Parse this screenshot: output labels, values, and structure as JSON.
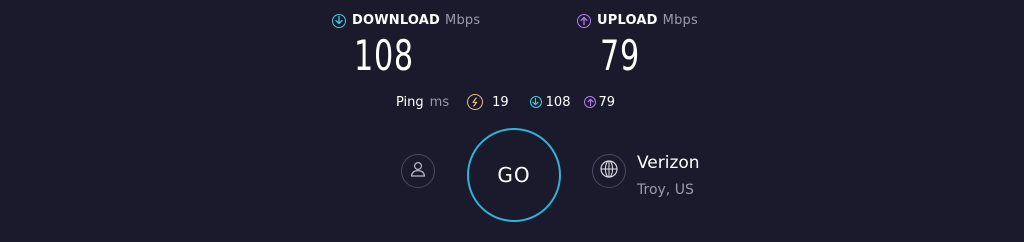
{
  "download": {
    "label": "DOWNLOAD",
    "unit": "Mbps",
    "value": "108",
    "icon": "download-arrow-icon",
    "color": "#3dd0e3"
  },
  "upload": {
    "label": "UPLOAD",
    "unit": "Mbps",
    "value": "79",
    "icon": "upload-arrow-icon",
    "color": "#b27df0"
  },
  "ping": {
    "label": "Ping",
    "unit": "ms",
    "idle_value": "19",
    "download_value": "108",
    "upload_value": "79",
    "idle_icon": "latency-icon",
    "idle_color": "#e6c07b"
  },
  "go_button": {
    "label": "GO",
    "ring_color": "#2fb4d6"
  },
  "server": {
    "provider": "Verizon",
    "location": "Troy, US",
    "icon": "globe-icon"
  },
  "account": {
    "icon": "user-icon"
  },
  "background": "#1b1a2d"
}
